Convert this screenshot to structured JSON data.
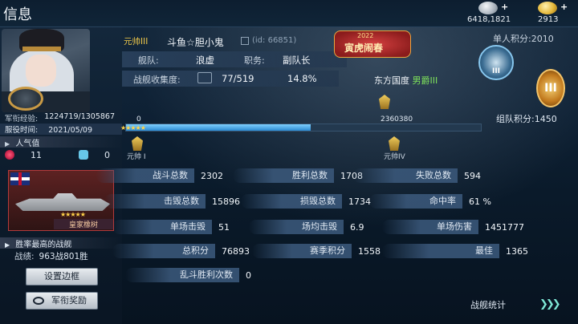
{
  "header": {
    "title": "信息"
  },
  "currency": {
    "silver": "6418,1821",
    "gold": "2913",
    "plus": "+"
  },
  "profile": {
    "rank_title": "元帅III",
    "nickname": "斗鱼☆胆小鬼",
    "uid": "(id: 66851)",
    "fleet_label": "舰队:",
    "fleet": "浪虚",
    "role_label": "职务:",
    "role": "副队长",
    "collection_label": "战舰收集度:",
    "collection": "77/519",
    "collection_pct": "14.8%",
    "country": "东方国度",
    "noble_title": "男爵III",
    "exp_label": "军衔经验:",
    "exp": "1224719/1305867",
    "service_label": "服役时间:",
    "service_date": "2021/05/09",
    "popularity_label": "人气值",
    "likes": "11",
    "dislikes": "0"
  },
  "banner": {
    "year": "2022",
    "text": "寅虎闹春"
  },
  "scores": {
    "personal": "单人积分:2010",
    "personal_badge": "III",
    "team": "组队积分:1450",
    "team_badge": "III"
  },
  "progress": {
    "start": "0",
    "marker": "2360380",
    "rank_left": "元帅 I",
    "rank_right": "元帅IV",
    "fill": 0.52
  },
  "best_ship": {
    "section_label": "胜率最高的战舰",
    "name": "皇家橡树",
    "stars": "★★★★★",
    "record_label": "战绩:",
    "record": "963战801胜"
  },
  "buttons": {
    "set_frame": "设置边框",
    "rank_reward": "军衔奖励"
  },
  "stats": [
    {
      "label": "战斗总数",
      "value": "2302"
    },
    {
      "label": "胜利总数",
      "value": "1708"
    },
    {
      "label": "失败总数",
      "value": "594"
    },
    {
      "label": "击毁总数",
      "value": "15896"
    },
    {
      "label": "损毁总数",
      "value": "1734"
    },
    {
      "label": "命中率",
      "value": "61 %"
    },
    {
      "label": "单场击毁",
      "value": "51"
    },
    {
      "label": "场均击毁",
      "value": "6.9"
    },
    {
      "label": "单场伤害",
      "value": "1451777"
    },
    {
      "label": "总积分",
      "value": "76893"
    },
    {
      "label": "赛季积分",
      "value": "1558"
    },
    {
      "label": "最佳",
      "value": "1365"
    },
    {
      "label": "乱斗胜利次数",
      "value": "0"
    }
  ],
  "footer": {
    "fleet_stats": "战舰统计"
  },
  "colors": {
    "accent_gold": "#f1c94a",
    "accent_green": "#7ee05b",
    "progress": "#2b8ad1"
  }
}
